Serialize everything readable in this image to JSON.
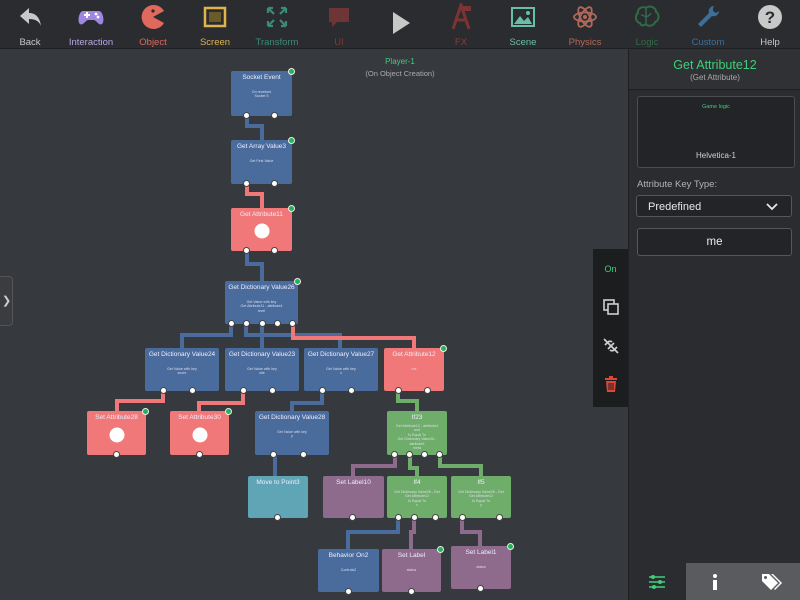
{
  "toolbar": {
    "items": [
      {
        "label": "Back",
        "icon": "back-arrow-icon",
        "color": "#c8c8c8"
      },
      {
        "label": "Interaction",
        "icon": "gamepad-icon",
        "color": "#b9a6e8"
      },
      {
        "label": "Object",
        "icon": "pacman-icon",
        "color": "#e0695d"
      },
      {
        "label": "Screen",
        "icon": "screen-frame-icon",
        "color": "#e0b34f"
      },
      {
        "label": "Transform",
        "icon": "transform-arrows-icon",
        "color": "#3a8a78"
      },
      {
        "label": "UI",
        "icon": "speech-bubble-icon",
        "color": "#7a3a3a"
      },
      {
        "label": "",
        "icon": "play-icon",
        "color": "#c8c8c8"
      },
      {
        "label": "FX",
        "icon": "fx-icon",
        "color": "#8a3b3b"
      },
      {
        "label": "Scene",
        "icon": "landscape-image-icon",
        "color": "#67c0a6"
      },
      {
        "label": "Physics",
        "icon": "atom-icon",
        "color": "#b06a5a"
      },
      {
        "label": "Logic",
        "icon": "brain-icon",
        "color": "#2f6b48"
      },
      {
        "label": "Custom",
        "icon": "wrench-icon",
        "color": "#3c6f9a"
      },
      {
        "label": "Help",
        "icon": "help-icon",
        "color": "#c8c8c8"
      }
    ]
  },
  "canvas": {
    "title": "Player-1",
    "subtitle": "(On Object Creation)",
    "side_tools": {
      "toggle_label": "On"
    }
  },
  "nodes": {
    "socket_event": {
      "title": "Socket Event",
      "body": "On received\nSocket 5",
      "color": "#4a6c9c"
    },
    "get_array_value3": {
      "title": "Get Array Value3",
      "body": "Get First Value",
      "color": "#4a6c9c"
    },
    "get_attribute11": {
      "title": "Get Attribute11",
      "body": "",
      "color": "#f17878"
    },
    "get_dictionary_value26": {
      "title": "Get Dictionary Value26",
      "body": "Get Value with key\nGet Attribute11 - attribute4\nlevel",
      "color": "#4a6c9c"
    },
    "get_dictionary_value24": {
      "title": "Get Dictionary Value24",
      "body": "Get Value with key\nscore",
      "color": "#4a6c9c"
    },
    "get_dictionary_value23": {
      "title": "Get Dictionary Value23",
      "body": "Get Value with key\nsite",
      "color": "#4a6c9c"
    },
    "get_dictionary_value27": {
      "title": "Get Dictionary Value27",
      "body": "Get Value with key\nx",
      "color": "#4a6c9c"
    },
    "get_attribute12": {
      "title": "Get Attribute12",
      "body": "me",
      "color": "#f17878"
    },
    "set_attribute28": {
      "title": "Set Attribute28",
      "body": "",
      "color": "#f17878"
    },
    "set_attribute30": {
      "title": "Set Attribute30",
      "body": "",
      "color": "#f17878"
    },
    "get_dictionary_value28": {
      "title": "Get Dictionary Value28",
      "body": "Get Value with key\ny",
      "color": "#4a6c9c"
    },
    "if23": {
      "title": "If23",
      "body": "Get Attribute12 - attribute4\nand\nIs Equal To\nGet Dictionary Value26 - attribute4\nmeta",
      "color": "#6fae6a"
    },
    "move_to_point3": {
      "title": "Move to Point3",
      "body": "",
      "color": "#5fa5b5"
    },
    "set_label10": {
      "title": "Set Label10",
      "body": "",
      "color": "#8e6a8c"
    },
    "if4": {
      "title": "If4",
      "body": "Get Dictionary Value26 - Get\nGet Attribute12\nIs Equal To\nx",
      "color": "#6fae6a"
    },
    "if5": {
      "title": "If5",
      "body": "Get Dictionary Value26 - Get\nGet Attribute12\nIs Equal To\ny",
      "color": "#6fae6a"
    },
    "behavior_on2": {
      "title": "Behavior On2",
      "body": "Controls2",
      "color": "#4a6c9c"
    },
    "set_label": {
      "title": "Set Label",
      "body": "status",
      "color": "#8e6a8c"
    },
    "set_label1": {
      "title": "Set Label1",
      "body": "status",
      "color": "#8e6a8c"
    }
  },
  "panel": {
    "title": "Get Attribute12",
    "subtitle": "(Get Attribute)",
    "preview_header": "Game logic",
    "preview_font": "Helvetica-1",
    "attribute_key_label": "Attribute Key Type:",
    "attribute_key_value": "Predefined",
    "value": "me",
    "tabs": [
      {
        "icon": "sliders-icon",
        "active": true
      },
      {
        "icon": "info-icon",
        "active": false
      },
      {
        "icon": "tags-icon",
        "active": false
      }
    ]
  },
  "colors": {
    "accent": "#3fcf7a",
    "wire_blue": "#4a6c9c",
    "wire_red": "#f17878",
    "wire_green": "#6fae6a",
    "wire_purple": "#8e6a8c",
    "delete": "#e0453a"
  }
}
